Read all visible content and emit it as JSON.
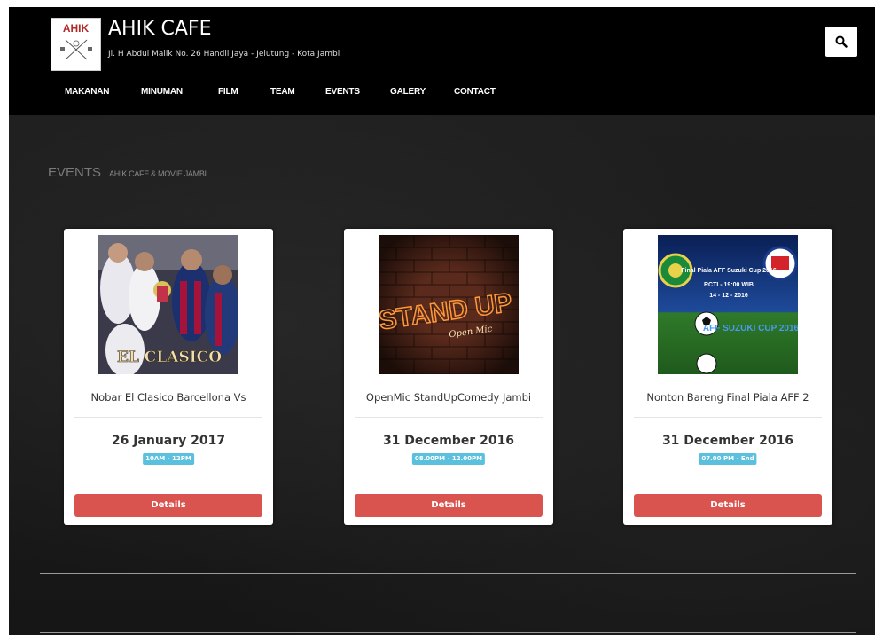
{
  "header": {
    "logo_text": "AHIK",
    "title": "AHIK CAFE",
    "address": "Jl. H Abdul Malik No. 26 Handil Jaya - Jelutung - Kota Jambi",
    "search_icon": "search-icon"
  },
  "nav": {
    "items": [
      {
        "label": "MAKANAN"
      },
      {
        "label": "MINUMAN"
      },
      {
        "label": "FILM"
      },
      {
        "label": "TEAM"
      },
      {
        "label": "EVENTS"
      },
      {
        "label": "GALERY"
      },
      {
        "label": "CONTACT"
      }
    ]
  },
  "section": {
    "title": "EVENTS",
    "subtitle": "AHIK CAFE & MOVIE JAMBI"
  },
  "events": [
    {
      "title": "Nobar El Clasico Barcellona Vs",
      "date": "26 January 2017",
      "time": "10AM - 12PM",
      "button": "Details",
      "image_text": "EL CLASICO"
    },
    {
      "title": "OpenMic StandUpComedy Jambi",
      "date": "31 December 2016",
      "time": "08.00PM - 12.00PM",
      "button": "Details",
      "image_text": "STAND UP",
      "image_subtext": "Open Mic"
    },
    {
      "title": "Nonton Bareng Final Piala AFF 2",
      "date": "31 December 2016",
      "time": "07.00 PM - End",
      "button": "Details",
      "image_text": "Final Piala AFF Suzuki Cup 2016",
      "image_subtext": "RCTI - 19:00 WIB",
      "image_date": "14 - 12 - 2016",
      "image_logo": "AFF SUZUKI CUP 2016"
    }
  ],
  "colors": {
    "accent_button": "#d9534f",
    "badge": "#5bc0de",
    "header_bg": "#000000",
    "page_bg": "#1d1d1d"
  }
}
